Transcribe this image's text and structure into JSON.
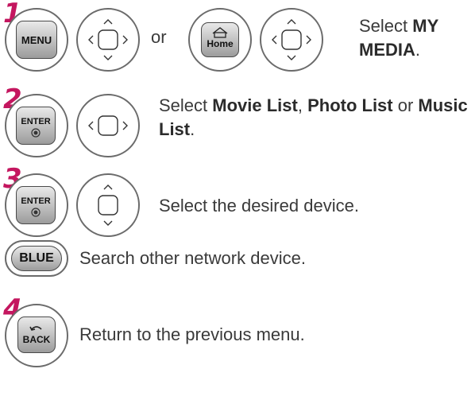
{
  "steps": [
    {
      "number": "1",
      "keys": [
        "MENU",
        "Home"
      ],
      "connector": "or",
      "text_prefix": "Select ",
      "text_bold": "MY MEDIA",
      "text_suffix": "."
    },
    {
      "number": "2",
      "keys": [
        "ENTER"
      ],
      "text_prefix": "Select ",
      "bold1": "Movie List",
      "sep1": ", ",
      "bold2": "Photo List",
      "sep2": " or ",
      "bold3": "Music List",
      "text_suffix": "."
    },
    {
      "number": "3",
      "keys": [
        "ENTER"
      ],
      "text": "Select the desired device."
    },
    {
      "number": "",
      "keys": [
        "BLUE"
      ],
      "text": "Search other network device."
    },
    {
      "number": "4",
      "keys": [
        "BACK"
      ],
      "text": "Return to the previous menu."
    }
  ],
  "colors": {
    "step_number": "#c4165f",
    "text": "#3a3a3a",
    "outline": "#6b6b6b"
  }
}
